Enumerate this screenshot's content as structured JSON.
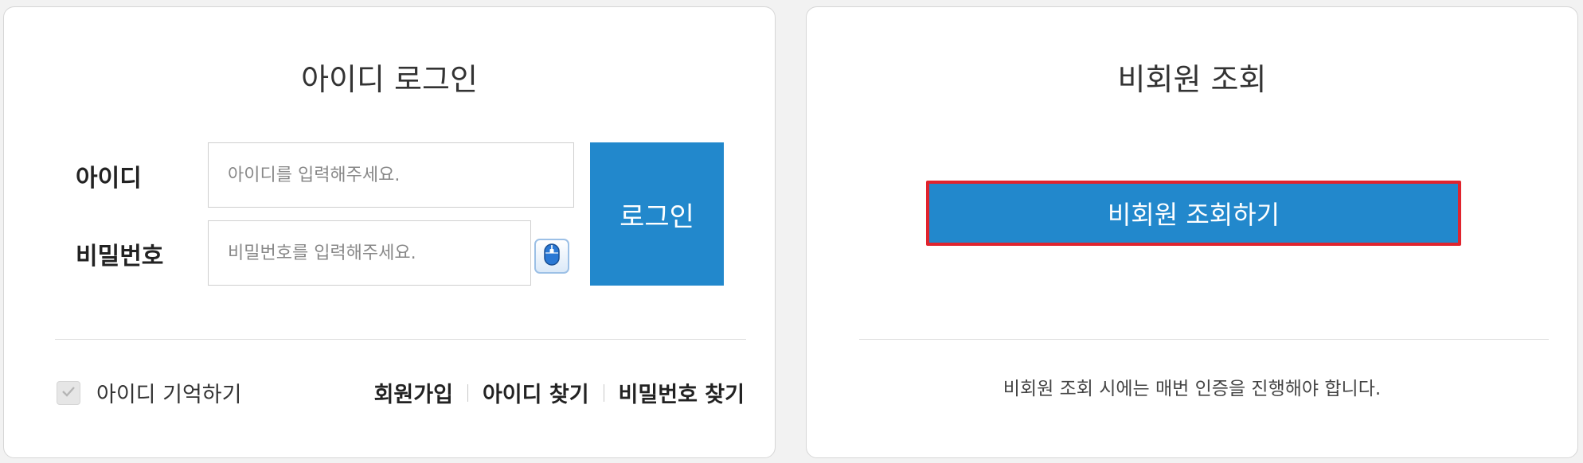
{
  "login": {
    "title": "아이디 로그인",
    "id_label": "아이디",
    "id_placeholder": "아이디를 입력해주세요.",
    "id_value": "",
    "pw_label": "비밀번호",
    "pw_placeholder": "비밀번호를 입력해주세요.",
    "pw_value": "",
    "keyboard_icon": "mouse-keyboard-icon",
    "login_button": "로그인",
    "remember_label": "아이디 기억하기",
    "remember_checked": false,
    "links": {
      "signup": "회원가입",
      "find_id": "아이디 찾기",
      "find_pw": "비밀번호 찾기"
    }
  },
  "guest": {
    "title": "비회원 조회",
    "lookup_button": "비회원 조회하기",
    "notice": "비회원 조회 시에는 매번 인증을 진행해야 합니다."
  },
  "colors": {
    "primary_button": "#2288cc",
    "highlight_border": "#e0242e",
    "page_background": "#f2f2f2"
  }
}
